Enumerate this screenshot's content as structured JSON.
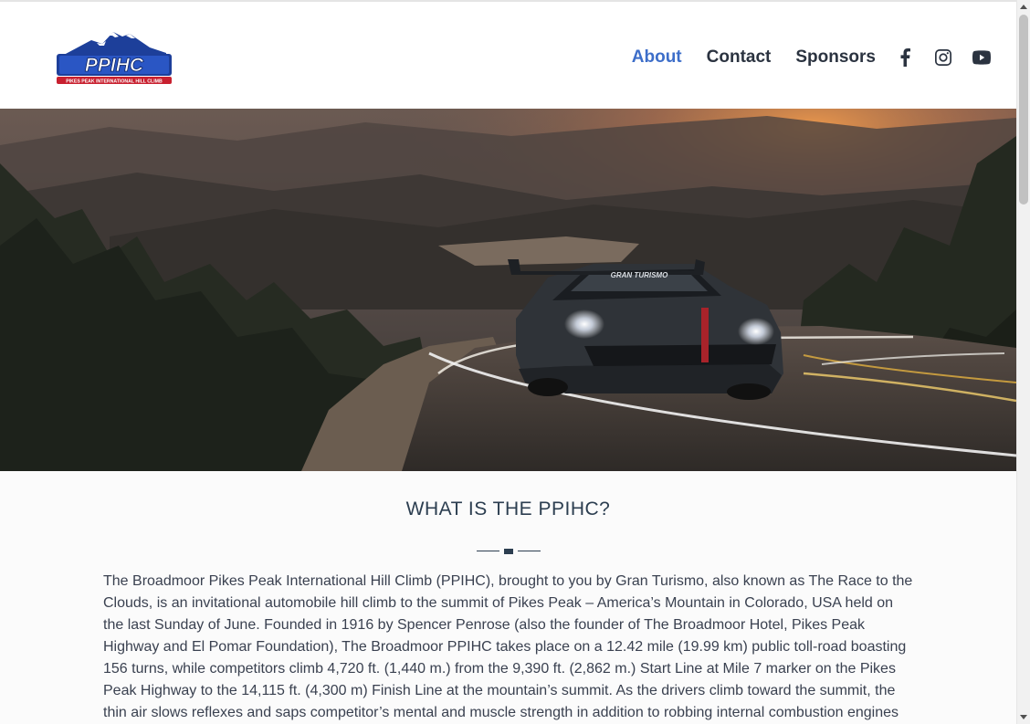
{
  "header": {
    "logo_text": "PPIHC",
    "logo_subtext": "PIKES PEAK INTERNATIONAL HILL CLIMB",
    "nav": [
      {
        "label": "About",
        "active": true
      },
      {
        "label": "Contact",
        "active": false
      },
      {
        "label": "Sponsors",
        "active": false
      }
    ],
    "social_icons": [
      "facebook-icon",
      "instagram-icon",
      "youtube-icon"
    ]
  },
  "hero": {
    "car_livery_text": "GRAN TURISMO"
  },
  "section": {
    "title": "WHAT IS THE PPIHC?",
    "body": "The Broadmoor Pikes Peak International Hill Climb (PPIHC), brought to you by Gran Turismo, also known as The Race to the Clouds, is an invitational automobile hill climb to the summit of Pikes Peak – America’s Mountain in Colorado, USA held on the last Sunday of June. Founded in 1916 by Spencer Penrose (also the founder of The Broadmoor Hotel, Pikes Peak Highway and El Pomar Foundation), The Broadmoor PPIHC takes place on a 12.42 mile (19.99 km) public toll-road boasting 156 turns, while competitors climb 4,720 ft. (1,440 m.) from the 9,390 ft. (2,862 m.) Start Line at Mile 7 marker on the Pikes Peak Highway to the 14,115 ft. (4,300 m) Finish Line at the mountain’s summit. As the drivers climb toward the summit, the thin air slows reflexes and saps competitor’s mental and muscle strength in addition to robbing internal combustion engines"
  },
  "colors": {
    "nav_active": "#3d6ec9",
    "nav_text": "#2b3340",
    "logo_blue": "#1d3f9a",
    "logo_red": "#c8202f"
  }
}
